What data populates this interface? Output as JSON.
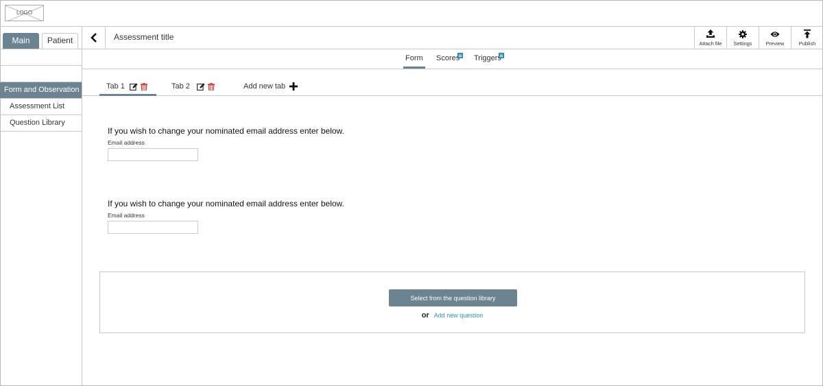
{
  "logo": {
    "text": "LOGO"
  },
  "sidebar": {
    "tabs": [
      {
        "label": "Main"
      },
      {
        "label": "Patient"
      }
    ],
    "section": "Form and Observation",
    "items": [
      {
        "label": "Assessment List"
      },
      {
        "label": "Question Library"
      }
    ]
  },
  "header": {
    "title": "Assessment title",
    "back_icon": "chevron-left-icon",
    "tools": [
      {
        "label": "Attach file",
        "icon": "upload-icon"
      },
      {
        "label": "Settings",
        "icon": "gear-icon"
      },
      {
        "label": "Preview",
        "icon": "eye-icon"
      },
      {
        "label": "Publish",
        "icon": "publish-icon"
      }
    ]
  },
  "view_tabs": [
    {
      "label": "Form",
      "active": true
    },
    {
      "label": "Scores",
      "badge": true
    },
    {
      "label": "Triggers",
      "badge": true
    }
  ],
  "form_tabs": {
    "tabs": [
      {
        "label": "Tab 1",
        "active": true
      },
      {
        "label": "Tab 2"
      }
    ],
    "add_label": "Add new tab"
  },
  "questions": [
    {
      "text": "If you wish to change your nominated email address enter below.",
      "label": "Email address",
      "value": ""
    },
    {
      "text": "If you wish to change your nominated email address enter below.",
      "label": "Email address",
      "value": ""
    }
  ],
  "add_section": {
    "library_button": "Select from the question library",
    "or_text": "or",
    "add_link": "Add new question"
  },
  "colors": {
    "accent": "#6c8492",
    "link": "#2e8fc9",
    "delete": "#d9342b",
    "badge": "#3a9bd5"
  }
}
